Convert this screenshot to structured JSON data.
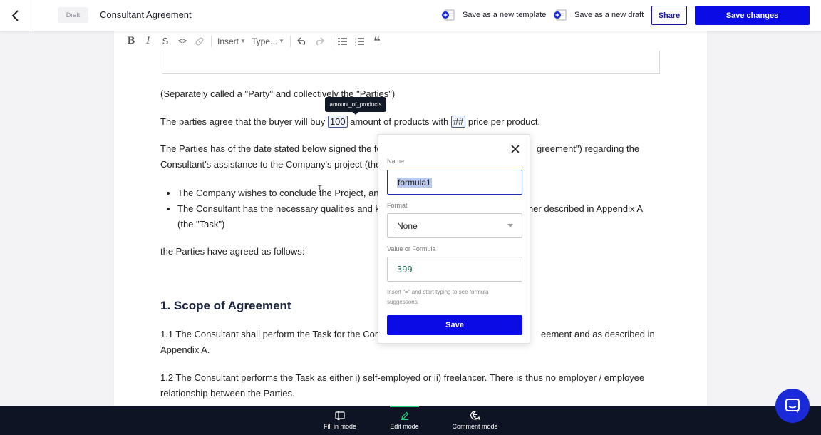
{
  "header": {
    "draft_badge": "Draft",
    "doc_title": "Consultant Agreement",
    "save_template_label": "Save as a new template",
    "save_draft_label": "Save as a new draft",
    "share_label": "Share",
    "save_changes_label": "Save changes"
  },
  "toolbar": {
    "insert_label": "Insert",
    "type_label": "Type..."
  },
  "document": {
    "p1": "(Separately called a \"Party\" and collectively the \"Parties\")",
    "p2_a": "The parties agree that the buyer will buy ",
    "p2_chip1": "100",
    "p2_b": " amount of products with ",
    "p2_chip2": "##",
    "p2_c": "  price per product.",
    "tooltip": "amount_of_products",
    "p3_line1_a": "The Parties has of the date stated below signed the fo",
    "p3_line1_b": "greement\") regarding the",
    "p3_line2": "Consultant's assistance to the Company's project (the",
    "bullet1": "The Company wishes to conclude the Project, and",
    "bullet2_a": "The Consultant has the necessary qualities and k",
    "bullet2_b": "rther described in Appendix A",
    "bullet2_line2": "(the \"Task\")",
    "p4": "the Parties have agreed as follows:",
    "heading": "1. Scope of Agreement",
    "p5_line1_a": "1.1 The Consultant shall perform the Task for the Com",
    "p5_line1_b": "eement and as described in",
    "p5_line2": "Appendix A.",
    "p6_line1": "1.2 The Consultant performs the Task as either i) self-employed or ii) freelancer. There is thus no employer / employee",
    "p6_line2": "relationship between the Parties."
  },
  "popup": {
    "name_label": "Name",
    "name_value": "formula1",
    "format_label": "Format",
    "format_value": "None",
    "value_label": "Value or Formula",
    "value_value": "399",
    "hint": "Insert \"=\" and start typing to see formula suggestions.",
    "save_label": "Save"
  },
  "bottom_bar": {
    "fill_in_label": "Fill in mode",
    "edit_label": "Edit mode",
    "comment_label": "Comment mode",
    "active_mode": "Edit mode"
  },
  "colors": {
    "primary": "#0b0be6",
    "bottom_bar": "#0e1424",
    "active_mode_indicator": "#1fd47a",
    "chat_button": "#1a2ad6"
  }
}
